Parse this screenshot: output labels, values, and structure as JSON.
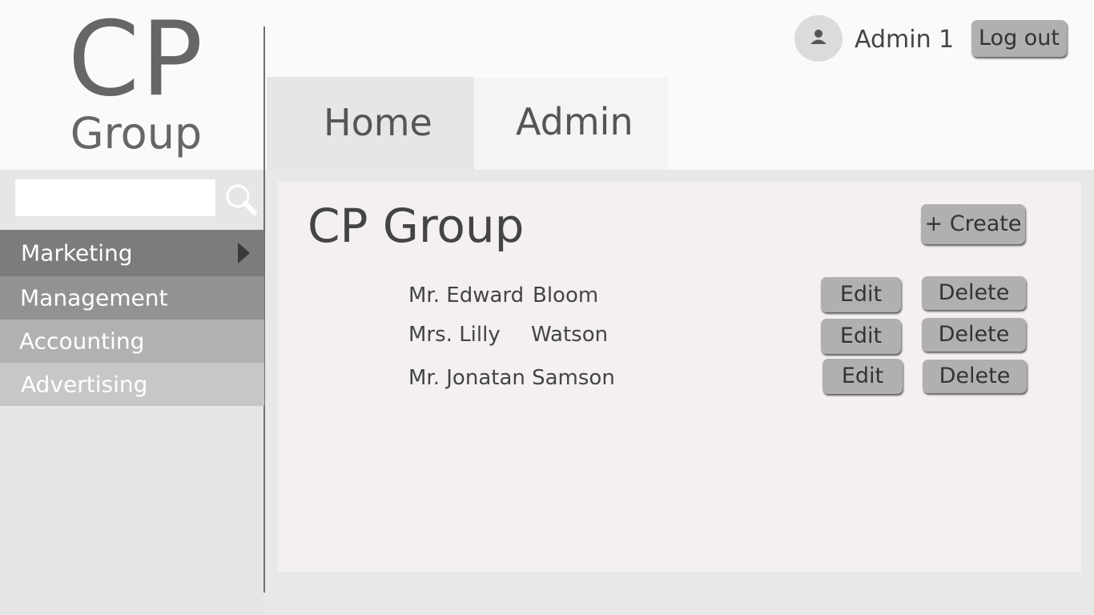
{
  "logo": {
    "line1": "CP",
    "line2": "Group"
  },
  "search": {
    "value": "",
    "placeholder": "",
    "icon": "search-icon"
  },
  "sidebar": {
    "items": [
      {
        "label": "Marketing",
        "active": true,
        "icon": "chevron-right-icon"
      },
      {
        "label": "Management"
      },
      {
        "label": "Accounting"
      },
      {
        "label": "Advertising"
      }
    ]
  },
  "user": {
    "avatar_icon": "user-icon",
    "name": "Admin 1",
    "logout_label": "Log out"
  },
  "tabs": [
    {
      "label": "Home",
      "active": true
    },
    {
      "label": "Admin"
    }
  ],
  "main": {
    "title": "CP Group",
    "create_label": "+ Create",
    "people": [
      {
        "first": "Mr. Edward",
        "last": "Bloom",
        "edit_label": "Edit",
        "delete_label": "Delete"
      },
      {
        "first": "Mrs. Lilly",
        "last": "Watson",
        "edit_label": "Edit",
        "delete_label": "Delete"
      },
      {
        "first": "Mr. Jonatan Samson",
        "last": "",
        "edit_label": "Edit",
        "delete_label": "Delete"
      }
    ]
  },
  "colors": {
    "background": "#e8e8e8",
    "header": "#fafafa",
    "panel": "#f4f0f0",
    "button": "#b1afaf",
    "sidebar_active": "#7d7b7b"
  }
}
